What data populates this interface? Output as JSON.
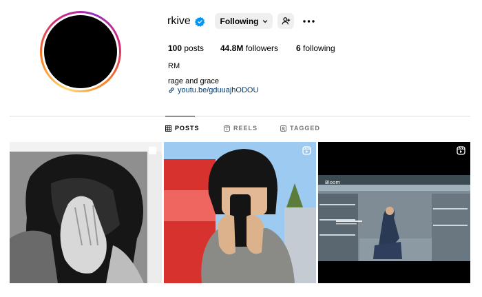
{
  "profile": {
    "username": "rkive",
    "verified": true,
    "following_button": "Following",
    "stats": {
      "posts_count": "100",
      "posts_label": "posts",
      "followers_count": "44.8M",
      "followers_label": "followers",
      "following_count": "6",
      "following_label": "following"
    },
    "full_name": "RM",
    "bio": "rage and grace",
    "link": "youtu.be/gduuajhODOU"
  },
  "tabs": [
    {
      "label": "POSTS",
      "active": true
    },
    {
      "label": "REELS",
      "active": false
    },
    {
      "label": "TAGGED",
      "active": false
    }
  ],
  "posts": [
    {
      "type": "carousel",
      "icon": "carousel-icon"
    },
    {
      "type": "reel",
      "icon": "reel-icon"
    },
    {
      "type": "reel",
      "icon": "reel-icon",
      "overlay_title": "Bloom"
    }
  ],
  "colors": {
    "verified": "#0095f6",
    "link": "#00376b",
    "button_bg": "#efefef",
    "divider": "#dbdbdb",
    "muted": "#737373"
  }
}
